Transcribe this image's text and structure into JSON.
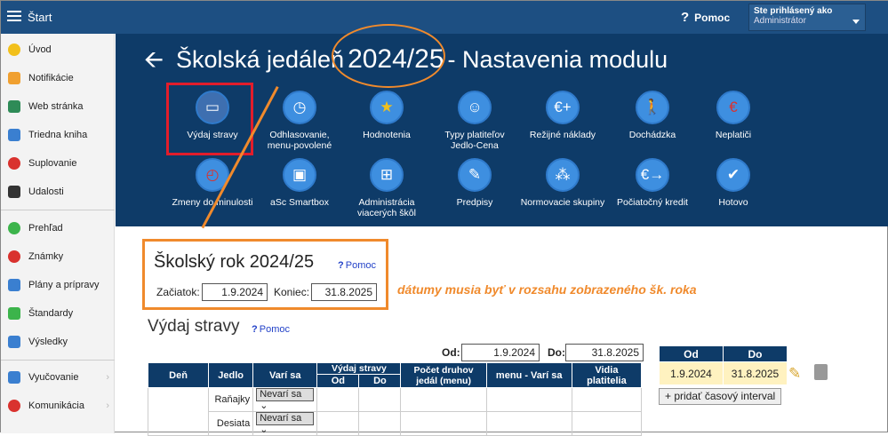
{
  "topbar": {
    "start": "Štart",
    "help": "Pomoc",
    "user_line1": "Ste prihlásený ako",
    "user_line2": "Administrátor"
  },
  "sidebar": {
    "group1": [
      "Úvod",
      "Notifikácie",
      "Web stránka",
      "Triedna kniha",
      "Suplovanie",
      "Udalosti"
    ],
    "group2": [
      "Prehľad",
      "Známky",
      "Plány a prípravy",
      "Štandardy",
      "Výsledky"
    ],
    "group3": [
      "Vyučovanie",
      "Komunikácia"
    ]
  },
  "header": {
    "title_pre": "Školská jedáleň",
    "title_year": "2024/25",
    "title_post": "- Nastavenia modulu",
    "modules_row1": [
      "Výdaj stravy",
      "Odhlasovanie, menu-povolené",
      "Hodnotenia",
      "Typy platiteľov Jedlo-Cena",
      "Režijné náklady",
      "Dochádzka",
      "Neplatiči"
    ],
    "modules_row2": [
      "Zmeny do minulosti",
      "aSc Smartbox",
      "Administrácia viacerých škôl",
      "Predpisy",
      "Normovacie skupiny",
      "Počiatočný kredit",
      "Hotovo"
    ]
  },
  "school_year": {
    "heading": "Školský rok 2024/25",
    "help": "Pomoc",
    "start_label": "Začiatok:",
    "start_value": "1.9.2024",
    "end_label": "Koniec:",
    "end_value": "31.8.2025"
  },
  "annotation": "dátumy musia byť v rozsahu zobrazeného šk. roka",
  "vydaj": {
    "heading": "Výdaj stravy",
    "help": "Pomoc",
    "od_label": "Od:",
    "od_value": "1.9.2024",
    "do_label": "Do:",
    "do_value": "31.8.2025"
  },
  "table": {
    "headers": [
      "Deň",
      "Jedlo",
      "Varí sa",
      "Výdaj stravy",
      "Počet druhov jedál (menu)",
      "menu - Varí sa",
      "Vidia platitelia"
    ],
    "sub_headers": [
      "Od",
      "Do"
    ],
    "rows": [
      {
        "jedlo": "Raňajky",
        "vari": "Nevarí sa"
      },
      {
        "jedlo": "Desiata",
        "vari": "Nevarí sa"
      }
    ]
  },
  "interval": {
    "headers": [
      "Od",
      "Do"
    ],
    "od": "1.9.2024",
    "do": "31.8.2025",
    "add_button": "+ pridať časový interval"
  },
  "colors": {
    "header_bg": "#0e3b68",
    "accent_orange": "#f08a2c",
    "highlight_red": "#e21d2b"
  }
}
